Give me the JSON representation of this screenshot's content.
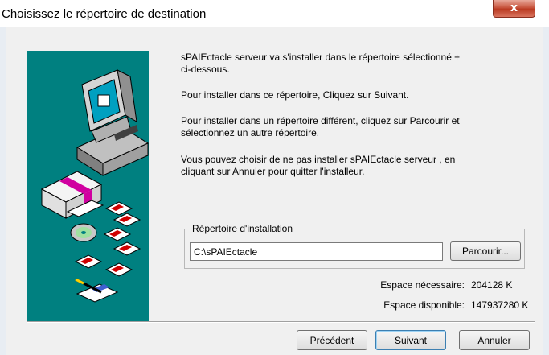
{
  "window": {
    "title": "Choisissez le répertoire de destination",
    "close_glyph": "x"
  },
  "icons": [
    "computer-icon",
    "software-box-icon",
    "floppy-disk-icon",
    "cd-disc-icon",
    "pen-paper-icon"
  ],
  "body": {
    "line1a": "sPAIEctacle serveur  va s'installer dans le répertoire sélectionné  ÷",
    "line1b": "ci-dessous.",
    "line2": "Pour installer dans ce répertoire, Cliquez sur Suivant.",
    "line3a": "Pour installer dans un répertoire différent, cliquez sur Parcourir et",
    "line3b": "sélectionnez un autre répertoire.",
    "line4a": "Vous pouvez choisir de ne pas installer  sPAIEctacle serveur , en",
    "line4b": "cliquant sur Annuler pour quitter l'installeur."
  },
  "install_dir": {
    "group_label": "Répertoire d'installation",
    "path_value": "C:\\sPAIEctacle",
    "browse_label": "Parcourir..."
  },
  "space": {
    "required_label": "Espace nécessaire:",
    "required_value": "204128 K",
    "available_label": "Espace disponible:",
    "available_value": "147937280 K"
  },
  "footer": {
    "back_label": "Précédent",
    "next_label": "Suivant",
    "cancel_label": "Annuler"
  },
  "colors": {
    "art_background": "#008080",
    "dialog_background": "#f0f0f0",
    "close_button": "#c8553e"
  }
}
